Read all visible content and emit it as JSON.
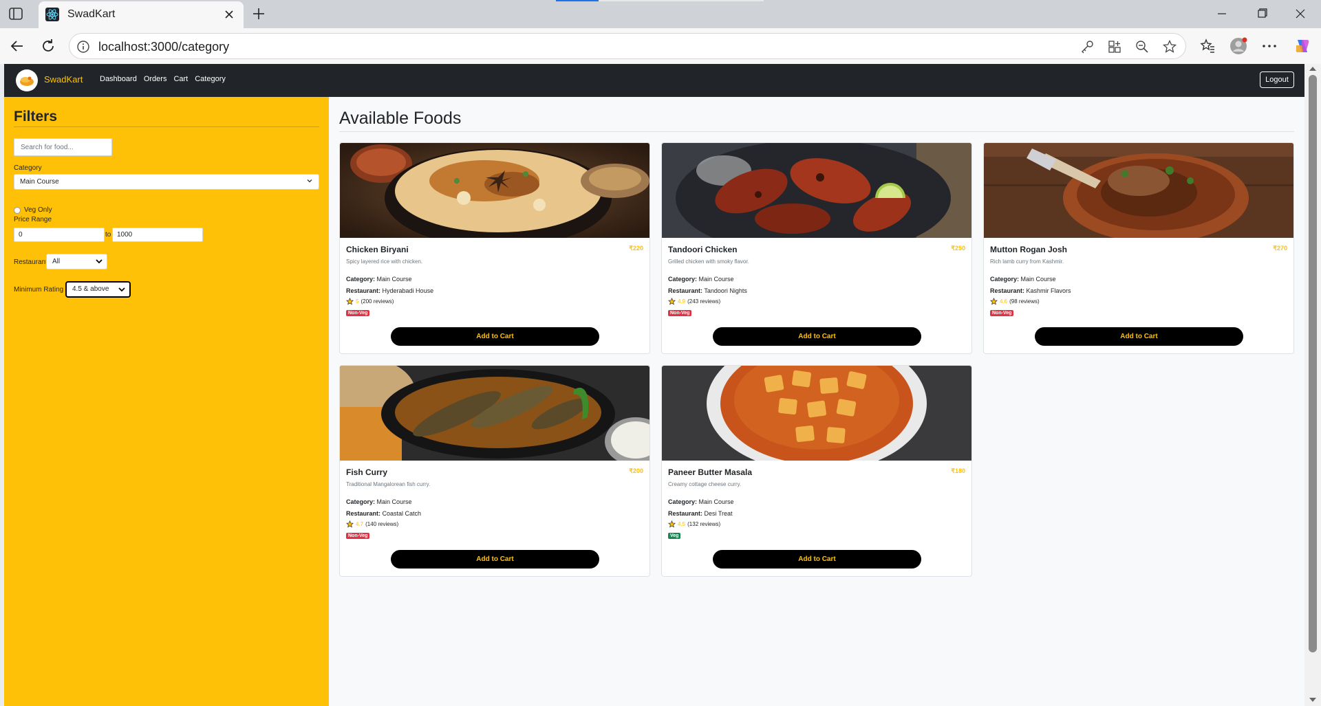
{
  "browser": {
    "tab_title": "SwadKart",
    "url": "localhost:3000/category",
    "icons": [
      "sidebar-toggle-icon",
      "react-favicon",
      "close-icon",
      "plus-icon",
      "minimize-icon",
      "maximize-icon",
      "close-window-icon",
      "back-icon",
      "reload-icon",
      "info-icon",
      "key-icon",
      "apps-icon",
      "zoom-out-icon",
      "star-icon",
      "favorites-icon",
      "profile-icon",
      "more-icon",
      "copilot-icon"
    ]
  },
  "navbar": {
    "brand": "SwadKart",
    "links": [
      "Dashboard",
      "Orders",
      "Cart",
      "Category"
    ],
    "logout": "Logout"
  },
  "filters": {
    "title": "Filters",
    "search_placeholder": "Search for food...",
    "category_label": "Category",
    "category_value": "Main Course",
    "veg_only_label": "Veg Only",
    "price_range_label": "Price Range",
    "price_min": "0",
    "price_to": "to",
    "price_max": "1000",
    "restaurant_label": "Restaurant",
    "restaurant_value": "All",
    "min_rating_label": "Minimum Rating",
    "min_rating_value": "4.5 & above"
  },
  "main": {
    "title": "Available Foods",
    "foods": [
      {
        "name": "Chicken Biryani",
        "price": "₹220",
        "description": "Spicy layered rice with chicken.",
        "category_label": "Category:",
        "category": "Main Course",
        "restaurant_label": "Restaurant:",
        "restaurant": "Hyderabadi House",
        "rating": "5",
        "reviews": "(200 reviews)",
        "type": "Non-Veg",
        "button": "Add to Cart"
      },
      {
        "name": "Tandoori Chicken",
        "price": "₹250",
        "description": "Grilled chicken with smoky flavor.",
        "category_label": "Category:",
        "category": "Main Course",
        "restaurant_label": "Restaurant:",
        "restaurant": "Tandoori Nights",
        "rating": "4.9",
        "reviews": "(243 reviews)",
        "type": "Non-Veg",
        "button": "Add to Cart"
      },
      {
        "name": "Mutton Rogan Josh",
        "price": "₹270",
        "description": "Rich lamb curry from Kashmir.",
        "category_label": "Category:",
        "category": "Main Course",
        "restaurant_label": "Restaurant:",
        "restaurant": "Kashmir Flavors",
        "rating": "4.6",
        "reviews": "(98 reviews)",
        "type": "Non-Veg",
        "button": "Add to Cart"
      },
      {
        "name": "Fish Curry",
        "price": "₹200",
        "description": "Traditional Mangalorean fish curry.",
        "category_label": "Category:",
        "category": "Main Course",
        "restaurant_label": "Restaurant:",
        "restaurant": "Coastal Catch",
        "rating": "4.7",
        "reviews": "(140 reviews)",
        "type": "Non-Veg",
        "button": "Add to Cart"
      },
      {
        "name": "Paneer Butter Masala",
        "price": "₹180",
        "description": "Creamy cottage cheese curry.",
        "category_label": "Category:",
        "category": "Main Course",
        "restaurant_label": "Restaurant:",
        "restaurant": "Desi Treat",
        "rating": "4.5",
        "reviews": "(132 reviews)",
        "type": "Veg",
        "button": "Add to Cart"
      }
    ]
  },
  "colors": {
    "accent": "#ffc107",
    "navbar": "#212529",
    "nonveg": "#dc3545",
    "veg": "#198754"
  }
}
